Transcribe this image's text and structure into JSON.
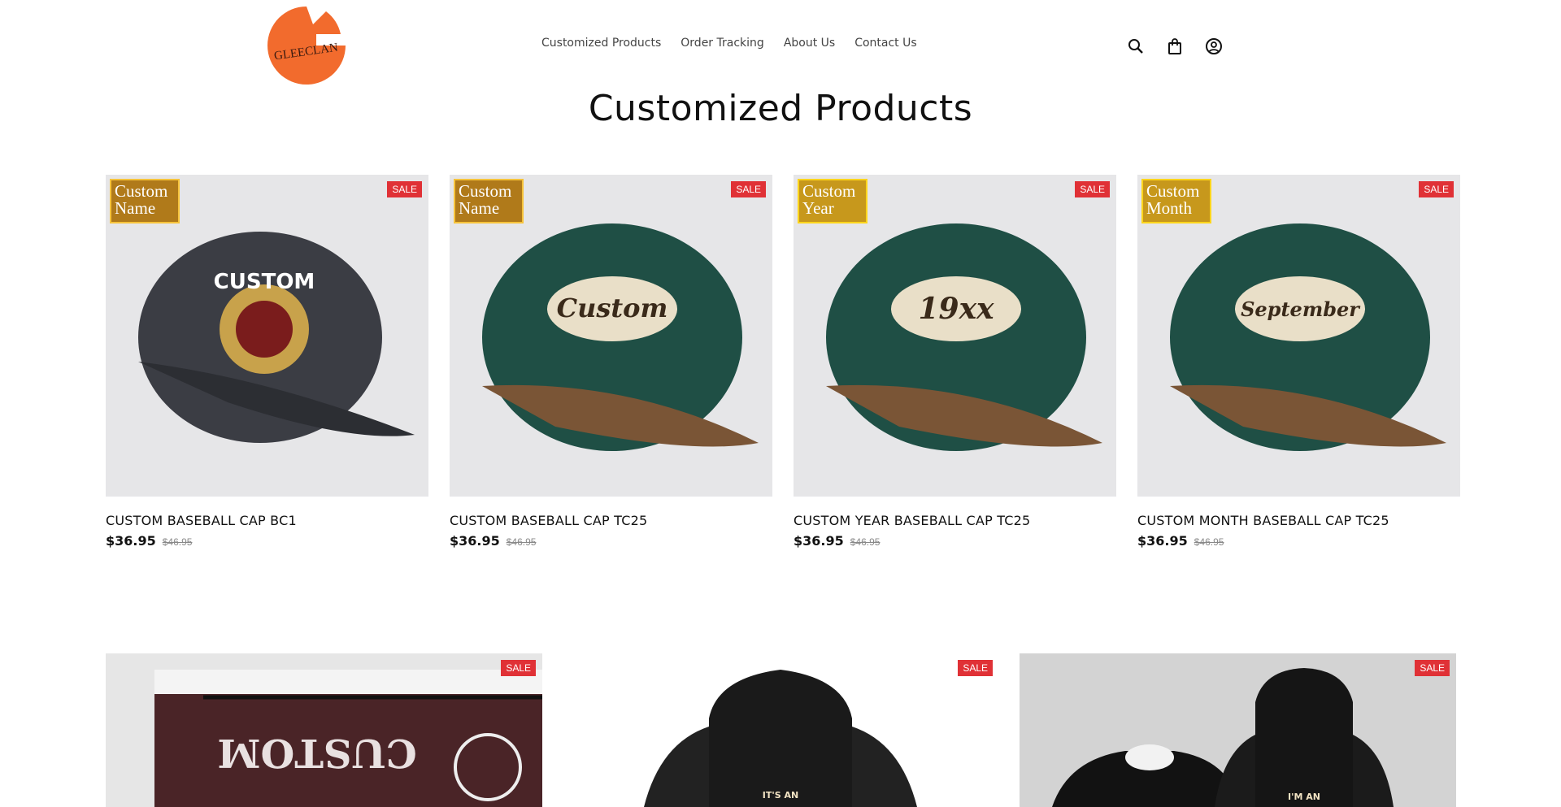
{
  "brand": {
    "logo_text": "GLEECLAN"
  },
  "nav": [
    {
      "label": "Customized Products"
    },
    {
      "label": "Order Tracking"
    },
    {
      "label": "About Us"
    },
    {
      "label": "Contact Us"
    }
  ],
  "header_icons": [
    "search-icon",
    "bag-icon",
    "account-icon"
  ],
  "page_title": "Customized Products",
  "sale_label": "SALE",
  "products": [
    {
      "name": "CUSTOM BASEBALL CAP BC1",
      "price": "$36.95",
      "compare_price": "$46.95",
      "badge": [
        "Custom",
        "Name"
      ],
      "cap_text": "CUSTOM",
      "cap_color": "#3b3d44"
    },
    {
      "name": "CUSTOM BASEBALL CAP TC25",
      "price": "$36.95",
      "compare_price": "$46.95",
      "badge": [
        "Custom",
        "Name"
      ],
      "cap_text": "Custom",
      "cap_color": "#1f4f45"
    },
    {
      "name": "CUSTOM YEAR BASEBALL CAP TC25",
      "price": "$36.95",
      "compare_price": "$46.95",
      "badge": [
        "Custom",
        "Year"
      ],
      "cap_text": "19xx",
      "cap_color": "#1f4f45"
    },
    {
      "name": "CUSTOM MONTH BASEBALL CAP TC25",
      "price": "$36.95",
      "compare_price": "$46.95",
      "badge": [
        "Custom",
        "Month"
      ],
      "cap_text": "September",
      "cap_color": "#1f4f45"
    }
  ],
  "row2": [
    {
      "image": "custom-shoe",
      "shoe_text": "CUSTOM"
    },
    {
      "image": "black-hoodie",
      "hoodie_text": "IT'S AN"
    },
    {
      "image": "black-hoodie-pair",
      "hoodie_text": "I'M AN"
    }
  ],
  "colors": {
    "sale": "#e03136",
    "logo": "#f26b2d",
    "badge_gold": "#b07a1a"
  }
}
